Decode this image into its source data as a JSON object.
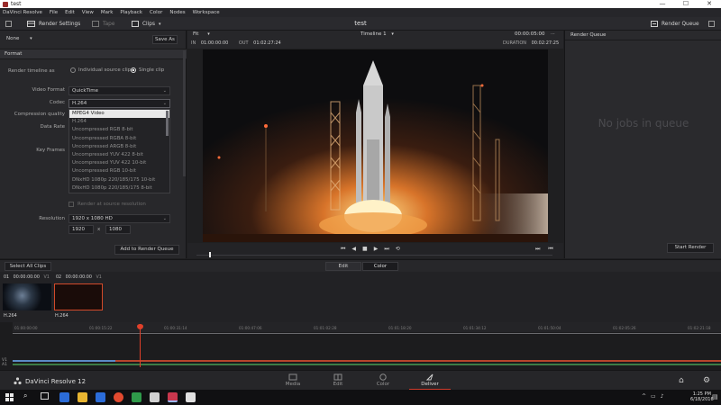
{
  "window": {
    "title": "test",
    "controls": [
      "—",
      "☐",
      "✕"
    ]
  },
  "menu": [
    "DaVinci Resolve",
    "File",
    "Edit",
    "View",
    "Mark",
    "Playback",
    "Color",
    "Nodes",
    "Workspace"
  ],
  "toolbar": {
    "render_settings": "Render Settings",
    "tape": "Tape",
    "clips": "Clips",
    "project_title": "test",
    "render_queue": "Render Queue"
  },
  "render_settings": {
    "preset": "None",
    "save_as": "Save As",
    "section": "Format",
    "render_timeline_as": "Render timeline as",
    "option_individual": "Individual source clips",
    "option_single": "Single clip",
    "video_format_label": "Video Format",
    "video_format_value": "QuickTime",
    "codec_label": "Codec",
    "codec_value": "H.264",
    "compression_label": "Compression quality",
    "data_rate_label": "Data Rate",
    "key_frames_label": "Key Frames",
    "codec_options": [
      "MPEG4 Video",
      "H.264",
      "Uncompressed RGB 8-bit",
      "Uncompressed RGBA 8-bit",
      "Uncompressed ARGB 8-bit",
      "Uncompressed YUV 422 8-bit",
      "Uncompressed YUV 422 10-bit",
      "Uncompressed RGB 10-bit",
      "DNxHD 1080p 220/185/175 10-bit",
      "DNxHD 1080p 220/185/175 8-bit"
    ],
    "render_source_res": "Render at source resolution",
    "resolution_label": "Resolution",
    "resolution_value": "1920 x 1080 HD",
    "width": "1920",
    "x": "x",
    "height": "1080",
    "add_to_queue": "Add to Render Queue"
  },
  "viewer": {
    "fit": "Fit",
    "timeline_name": "Timeline 1",
    "timecode": "00:00:05:00",
    "in_label": "IN",
    "in_value": "01:00:00:00",
    "out_label": "OUT",
    "out_value": "01:02:27:24",
    "duration_label": "DURATION",
    "duration_value": "00:02:27:25"
  },
  "render_queue": {
    "title": "Render Queue",
    "empty": "No jobs in queue",
    "start": "Start Render"
  },
  "midbar": {
    "select_all": "Select All Clips",
    "edit": "Edit",
    "color": "Color"
  },
  "clips": [
    {
      "index": "01",
      "tc": "00:00:00:00",
      "track": "V1",
      "name": "H.264"
    },
    {
      "index": "02",
      "tc": "00:00:00:00",
      "track": "V1",
      "name": "H.264"
    }
  ],
  "timeline": {
    "ticks": [
      "01:00:00:00",
      "01:00:15:22",
      "01:00:31:14",
      "01:00:47:06",
      "01:01:02:28",
      "01:01:18:20",
      "01:01:34:12",
      "01:01:50:04",
      "01:02:05:26",
      "01:02:21:18"
    ],
    "track_v1": "V1",
    "track_a1": "A1"
  },
  "pages": {
    "app_name": "DaVinci Resolve 12",
    "items": [
      "Media",
      "Edit",
      "Color",
      "Deliver"
    ],
    "active": "Deliver"
  },
  "taskbar": {
    "time": "1:25 PM",
    "date": "6/18/2016",
    "icon_colors": [
      "#2b6cd8",
      "#e8b531",
      "#e24a2f",
      "#2f9a4a",
      "#d0d0d0",
      "#c8374d",
      "#e0e0e0"
    ]
  }
}
